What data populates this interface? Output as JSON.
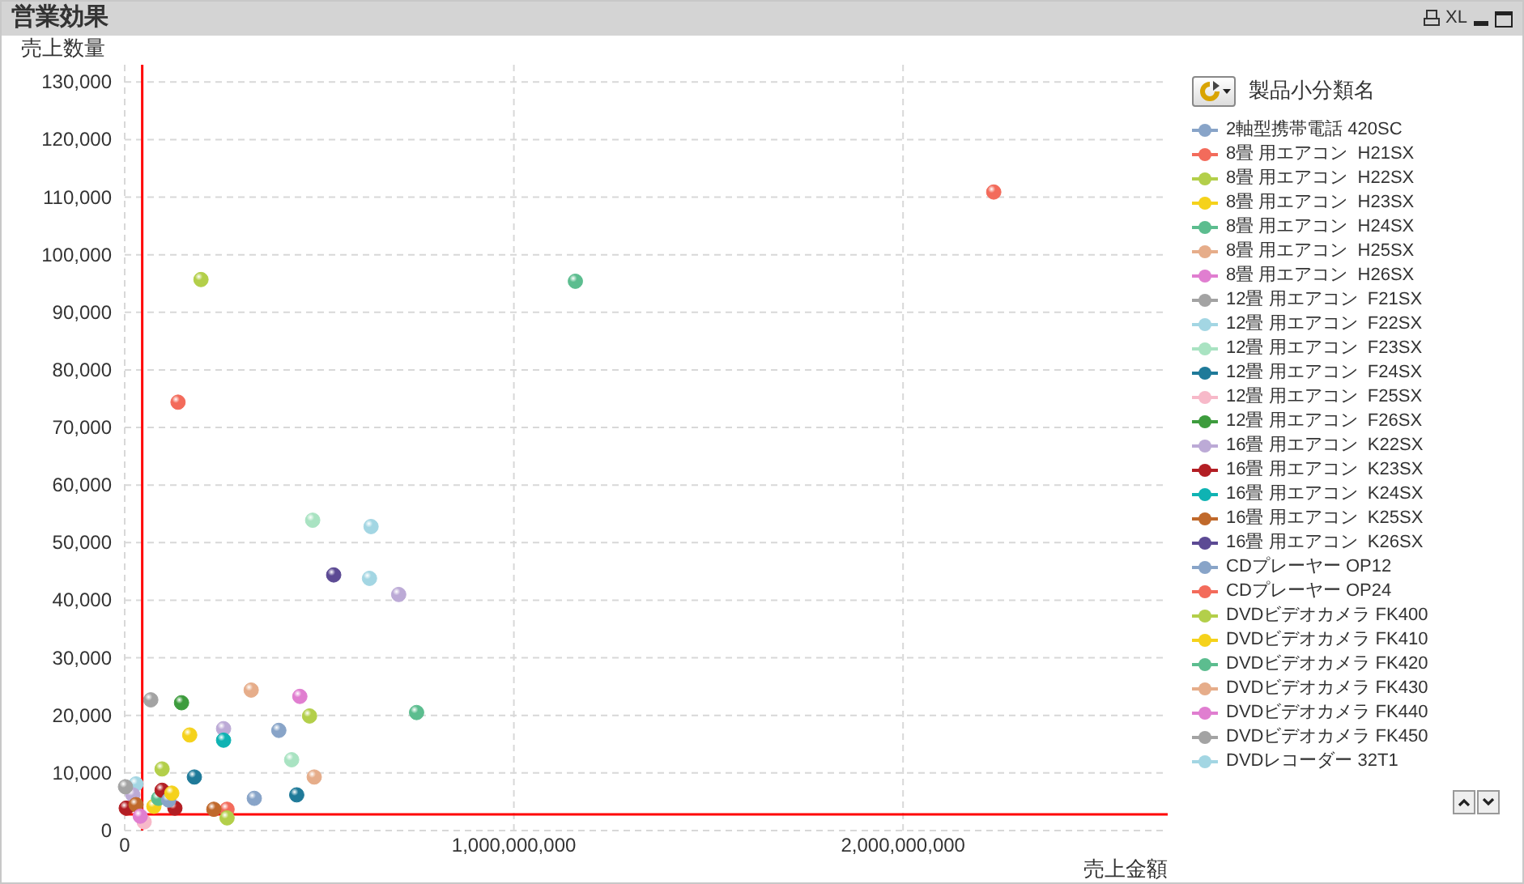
{
  "window": {
    "title": "営業効果",
    "buttons": [
      {
        "kind": "print"
      },
      {
        "kind": "text",
        "label": "XL"
      },
      {
        "kind": "minimize"
      },
      {
        "kind": "maximize"
      }
    ]
  },
  "chart": {
    "chart_data": {
      "type": "scatter",
      "xlabel": "売上金額",
      "ylabel": "売上数量",
      "xlim": [
        0,
        2680000000
      ],
      "ylim": [
        0,
        133000
      ],
      "grid": true,
      "xticks": [
        {
          "value": 0,
          "label": "0"
        },
        {
          "value": 1000000000,
          "label": "1,000,000,000"
        },
        {
          "value": 2000000000,
          "label": "2,000,000,000"
        }
      ],
      "yticks": [
        {
          "value": 0,
          "label": "0"
        },
        {
          "value": 10000,
          "label": "10,000"
        },
        {
          "value": 20000,
          "label": "20,000"
        },
        {
          "value": 30000,
          "label": "30,000"
        },
        {
          "value": 40000,
          "label": "40,000"
        },
        {
          "value": 50000,
          "label": "50,000"
        },
        {
          "value": 60000,
          "label": "60,000"
        },
        {
          "value": 70000,
          "label": "70,000"
        },
        {
          "value": 80000,
          "label": "80,000"
        },
        {
          "value": 90000,
          "label": "90,000"
        },
        {
          "value": 100000,
          "label": "100,000"
        },
        {
          "value": 110000,
          "label": "110,000"
        },
        {
          "value": 120000,
          "label": "120,000"
        },
        {
          "value": 130000,
          "label": "130,000"
        }
      ],
      "series": [
        {
          "name": "2軸型携帯電話 420SC",
          "color": "#88a4c8",
          "x": [
            333000000
          ],
          "values": [
            5600
          ]
        },
        {
          "name": "8畳 用エアコン  H21SX",
          "color": "#f36b5b",
          "x": [
            2233000000,
            263000000
          ],
          "values": [
            110900,
            3700
          ]
        },
        {
          "name": "8畳 用エアコン  H22SX",
          "color": "#b3cf4a",
          "x": [
            196000000
          ],
          "values": [
            95700
          ]
        },
        {
          "name": "8畳 用エアコン  H23SX",
          "color": "#f5d21b",
          "x": [
            167000000,
            75000000
          ],
          "values": [
            16600,
            4200
          ]
        },
        {
          "name": "8畳 用エアコン  H24SX",
          "color": "#5cbd8f",
          "x": [
            1158000000,
            87000000
          ],
          "values": [
            95400,
            5600
          ]
        },
        {
          "name": "8畳 用エアコン  H25SX",
          "color": "#e6ad8a",
          "x": [
            325000000
          ],
          "values": [
            24400
          ]
        },
        {
          "name": "8畳 用エアコン  H26SX",
          "color": "#e07ed0",
          "x": [
            450000000
          ],
          "values": [
            23300
          ]
        },
        {
          "name": "12畳 用エアコン  F21SX",
          "color": "#a3a3a3",
          "x": [
            67000000
          ],
          "values": [
            22700
          ]
        },
        {
          "name": "12畳 用エアコン  F22SX",
          "color": "#a3d6e3",
          "x": [
            633000000,
            29000000
          ],
          "values": [
            52800,
            8100
          ]
        },
        {
          "name": "12畳 用エアコン  F23SX",
          "color": "#a9e3c2",
          "x": [
            483000000,
            429000000
          ],
          "values": [
            53900,
            12300
          ]
        },
        {
          "name": "12畳 用エアコン  F24SX",
          "color": "#1f7a99",
          "x": [
            179000000,
            442000000
          ],
          "values": [
            9300,
            6200
          ]
        },
        {
          "name": "12畳 用エアコン  F25SX",
          "color": "#f7b9c9",
          "x": [
            50000000
          ],
          "values": [
            1500
          ]
        },
        {
          "name": "12畳 用エアコン  F26SX",
          "color": "#3d9c3d",
          "x": [
            146000000
          ],
          "values": [
            22200
          ]
        },
        {
          "name": "16畳 用エアコン  K22SX",
          "color": "#bcaad6",
          "x": [
            704000000,
            254000000,
            21000000
          ],
          "values": [
            41000,
            17700,
            6200
          ]
        },
        {
          "name": "16畳 用エアコン  K23SX",
          "color": "#b31e24",
          "x": [
            96000000,
            4000000,
            129000000
          ],
          "values": [
            7000,
            3900,
            3900
          ]
        },
        {
          "name": "16畳 用エアコン  K24SX",
          "color": "#0fb3b3",
          "x": [
            254000000
          ],
          "values": [
            15700
          ]
        },
        {
          "name": "16畳 用エアコン  K25SX",
          "color": "#c0692b",
          "x": [
            29000000,
            229000000
          ],
          "values": [
            4500,
            3700
          ]
        },
        {
          "name": "16畳 用エアコン  K26SX",
          "color": "#5c4a94",
          "x": [
            537000000
          ],
          "values": [
            44400
          ]
        },
        {
          "name": "CDプレーヤー OP12",
          "color": "#88a4c8",
          "x": [
            396000000,
            113000000
          ],
          "values": [
            17400,
            5300
          ]
        },
        {
          "name": "CDプレーヤー OP24",
          "color": "#f36b5b",
          "x": [
            137000000
          ],
          "values": [
            74400
          ]
        },
        {
          "name": "DVDビデオカメラ FK400",
          "color": "#b3cf4a",
          "x": [
            475000000,
            96000000,
            263000000
          ],
          "values": [
            19900,
            10700,
            2200
          ]
        },
        {
          "name": "DVDビデオカメラ FK410",
          "color": "#f5d21b",
          "x": [
            121000000
          ],
          "values": [
            6500
          ]
        },
        {
          "name": "DVDビデオカメラ FK420",
          "color": "#5cbd8f",
          "x": [
            750000000
          ],
          "values": [
            20500
          ]
        },
        {
          "name": "DVDビデオカメラ FK430",
          "color": "#e6ad8a",
          "x": [
            487000000
          ],
          "values": [
            9300
          ]
        },
        {
          "name": "DVDビデオカメラ FK440",
          "color": "#e07ed0",
          "x": [
            40000000
          ],
          "values": [
            2500
          ]
        },
        {
          "name": "DVDビデオカメラ FK450",
          "color": "#a3a3a3",
          "x": [
            2000000
          ],
          "values": [
            7600
          ]
        },
        {
          "name": "DVDレコーダー 32T1",
          "color": "#a3d6e3",
          "x": [
            629000000
          ],
          "values": [
            43800
          ]
        }
      ],
      "ref_lines": [
        {
          "axis": "x",
          "value": 45000000
        },
        {
          "axis": "y",
          "value": 2800
        }
      ]
    },
    "legend": {
      "title": "製品小分類名"
    }
  }
}
